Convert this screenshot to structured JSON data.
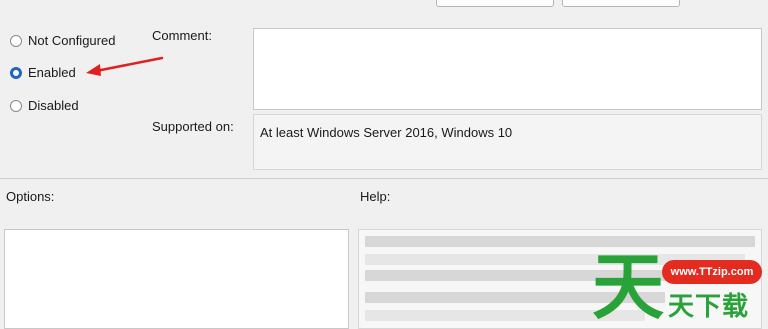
{
  "state": {
    "options": [
      {
        "label": "Not Configured",
        "checked": false
      },
      {
        "label": "Enabled",
        "checked": true
      },
      {
        "label": "Disabled",
        "checked": false
      }
    ]
  },
  "fields": {
    "comment_label": "Comment:",
    "comment_value": "",
    "supported_label": "Supported on:",
    "supported_value": "At least Windows Server 2016, Windows 10"
  },
  "panels": {
    "options_label": "Options:",
    "help_label": "Help:"
  },
  "watermark": {
    "url": "www.TTzip.com",
    "logo_char": "天",
    "text": "天下载"
  },
  "colors": {
    "accent": "#1f66c2",
    "annotation_arrow": "#e02020",
    "watermark_green": "#2aa23a",
    "watermark_red": "#e32b1f"
  }
}
